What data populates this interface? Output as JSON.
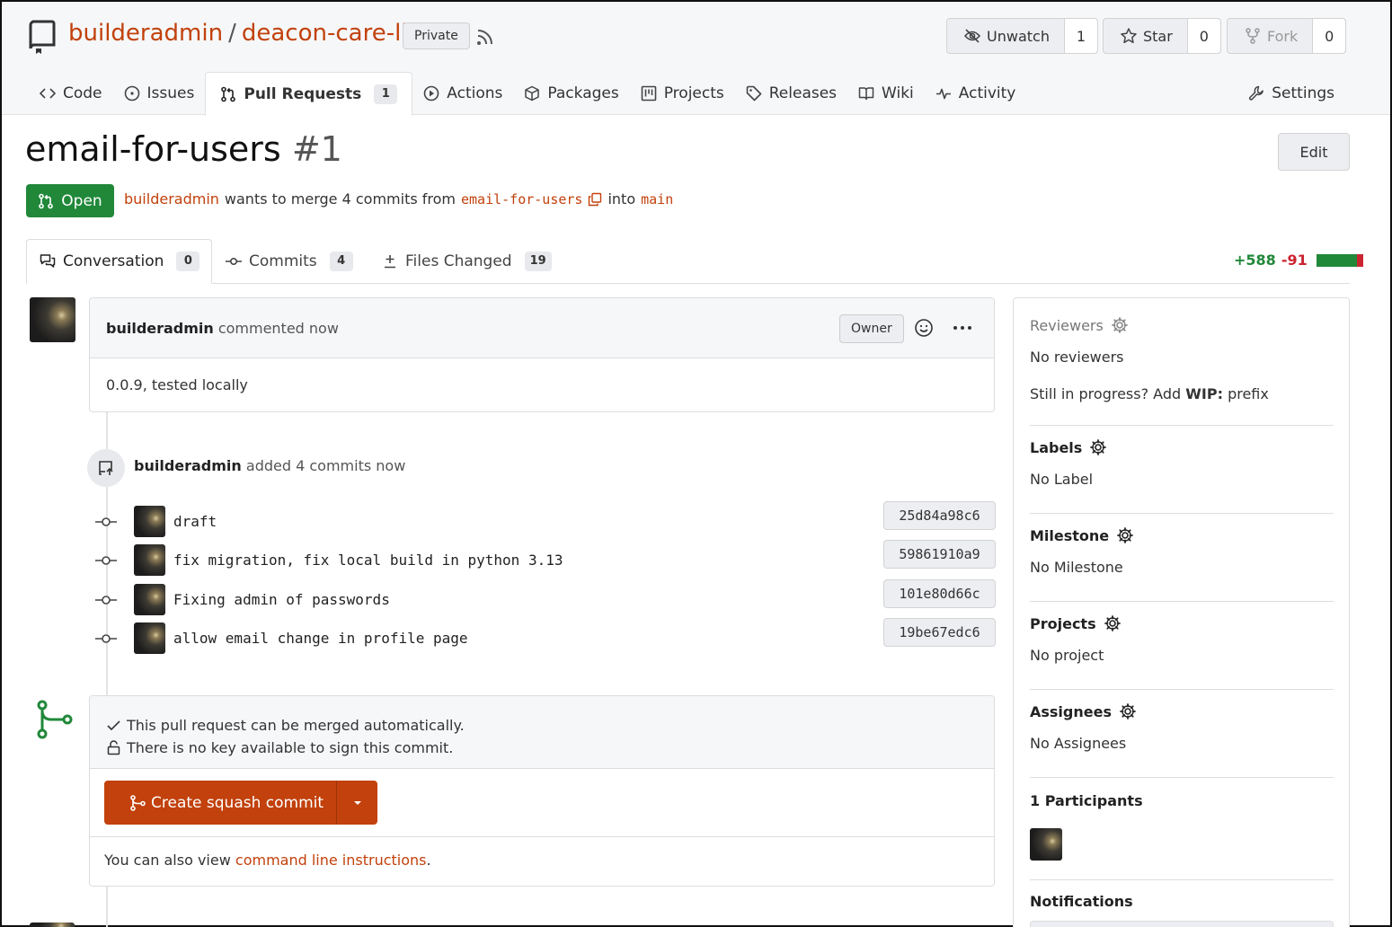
{
  "repo": {
    "owner": "builderadmin",
    "separator": "/",
    "name": "deacon-care-list",
    "visibility": "Private"
  },
  "header_buttons": {
    "unwatch": {
      "label": "Unwatch",
      "count": "1"
    },
    "star": {
      "label": "Star",
      "count": "0"
    },
    "fork": {
      "label": "Fork",
      "count": "0"
    }
  },
  "nav": {
    "code": "Code",
    "issues": "Issues",
    "pull_requests": "Pull Requests",
    "pull_requests_count": "1",
    "actions": "Actions",
    "packages": "Packages",
    "projects": "Projects",
    "releases": "Releases",
    "wiki": "Wiki",
    "activity": "Activity",
    "settings": "Settings"
  },
  "pr": {
    "title": "email-for-users",
    "number": "#1",
    "edit_label": "Edit",
    "state": "Open",
    "author": "builderadmin",
    "merge_text_1": "wants to merge 4 commits from",
    "head_branch": "email-for-users",
    "merge_text_2": "into",
    "base_branch": "main"
  },
  "tabs": {
    "conversation": "Conversation",
    "conversation_count": "0",
    "commits": "Commits",
    "commits_count": "4",
    "files_changed": "Files Changed",
    "files_changed_count": "19"
  },
  "diffstat": {
    "additions": "+588",
    "deletions": "-91",
    "additions_n": 588,
    "deletions_n": 91,
    "add_color": "#21883a",
    "del_color": "#cb2431"
  },
  "comment": {
    "author": "builderadmin",
    "action": "commented now",
    "role": "Owner",
    "body": "0.0.9, tested locally"
  },
  "commits_event": {
    "author": "builderadmin",
    "text": "added 4 commits now"
  },
  "commits": [
    {
      "message": "draft",
      "sha": "25d84a98c6"
    },
    {
      "message": "fix migration, fix local build in python 3.13",
      "sha": "59861910a9"
    },
    {
      "message": "Fixing admin of passwords",
      "sha": "101e80d66c"
    },
    {
      "message": "allow email change in profile page",
      "sha": "19be67edc6"
    }
  ],
  "merge": {
    "status_ok": "This pull request can be merged automatically.",
    "status_key": "There is no key available to sign this commit.",
    "button_label": "Create squash commit",
    "cli_prefix": "You can also view",
    "cli_link": "command line instructions",
    "cli_suffix": "."
  },
  "sidebar": {
    "reviewers_title": "Reviewers",
    "reviewers_value": "No reviewers",
    "wip_prefix_text": "Still in progress? Add",
    "wip_bold": "WIP:",
    "wip_suffix": "prefix",
    "labels_title": "Labels",
    "labels_value": "No Label",
    "milestone_title": "Milestone",
    "milestone_value": "No Milestone",
    "projects_title": "Projects",
    "projects_value": "No project",
    "assignees_title": "Assignees",
    "assignees_value": "No Assignees",
    "participants_title": "1 Participants",
    "notifications_title": "Notifications"
  },
  "colors": {
    "accent": "#c2410c",
    "open_green": "#21883a"
  }
}
